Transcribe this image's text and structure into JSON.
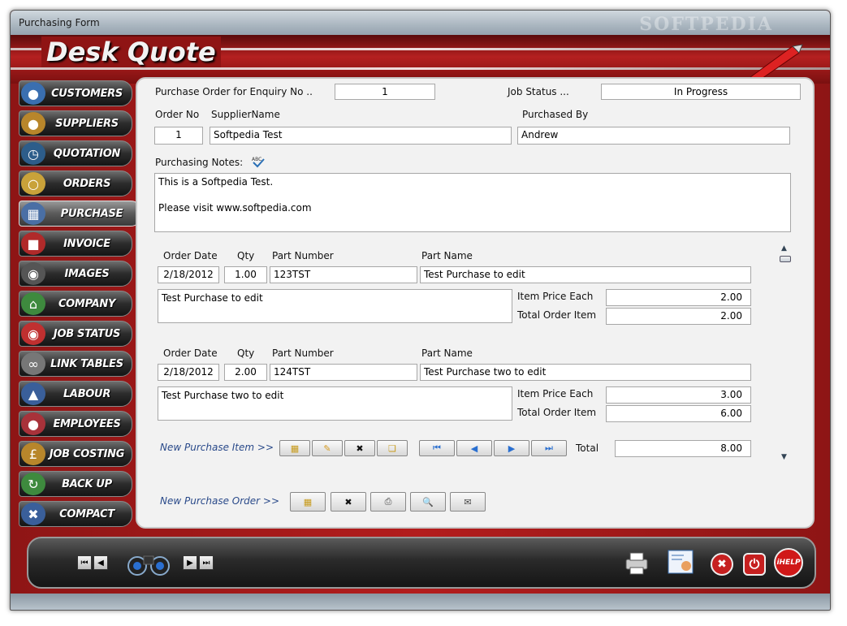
{
  "window": {
    "title": "Purchasing Form",
    "watermark": "SOFTPEDIA"
  },
  "app": {
    "logo": "Desk Quote"
  },
  "sidebar": {
    "items": [
      {
        "label": "CUSTOMERS",
        "icon": "customers-icon"
      },
      {
        "label": "SUPPLIERS",
        "icon": "suppliers-icon"
      },
      {
        "label": "QUOTATION",
        "icon": "quotation-icon"
      },
      {
        "label": "ORDERS",
        "icon": "orders-icon"
      },
      {
        "label": "PURCHASE",
        "icon": "purchase-icon"
      },
      {
        "label": "INVOICE",
        "icon": "invoice-icon"
      },
      {
        "label": "IMAGES",
        "icon": "images-icon"
      },
      {
        "label": "COMPANY",
        "icon": "company-icon"
      },
      {
        "label": "JOB STATUS",
        "icon": "job-status-icon"
      },
      {
        "label": "LINK TABLES",
        "icon": "link-tables-icon"
      },
      {
        "label": "LABOUR",
        "icon": "labour-icon"
      },
      {
        "label": "EMPLOYEES",
        "icon": "employees-icon"
      },
      {
        "label": "JOB COSTING",
        "icon": "job-costing-icon"
      },
      {
        "label": "BACK UP",
        "icon": "back-up-icon"
      },
      {
        "label": "COMPACT",
        "icon": "compact-icon"
      }
    ],
    "active": "PURCHASE"
  },
  "form": {
    "enquiry_label": "Purchase Order for Enquiry No ..",
    "enquiry_value": "1",
    "job_status_label": "Job Status ...",
    "job_status_value": "In Progress",
    "order_no_label": "Order No",
    "order_no_value": "1",
    "supplier_label": "SupplierName",
    "supplier_value": "Softpedia Test",
    "purchased_by_label": "Purchased By",
    "purchased_by_value": "Andrew",
    "notes_label": "Purchasing Notes:",
    "notes_value": "This is a Softpedia Test.\n\nPlease visit www.softpedia.com"
  },
  "items_headers": {
    "order_date": "Order Date",
    "qty": "Qty",
    "part_number": "Part Number",
    "part_name": "Part Name",
    "item_price": "Item Price Each",
    "total_order_item": "Total Order Item"
  },
  "items": [
    {
      "order_date": "2/18/2012",
      "qty": "1.00",
      "part_number": "123TST",
      "part_name": "Test Purchase to edit",
      "description": "Test Purchase to edit",
      "price": "2.00",
      "total": "2.00"
    },
    {
      "order_date": "2/18/2012",
      "qty": "2.00",
      "part_number": "124TST",
      "part_name": "Test Purchase two to edit",
      "description": "Test Purchase two to edit",
      "price": "3.00",
      "total": "6.00"
    }
  ],
  "item_toolbar": {
    "new_label": "New Purchase Item >>",
    "total_label": "Total",
    "total_value": "8.00"
  },
  "order_toolbar": {
    "new_label": "New Purchase Order >>"
  },
  "footer": {
    "help_label": "iHELP"
  }
}
